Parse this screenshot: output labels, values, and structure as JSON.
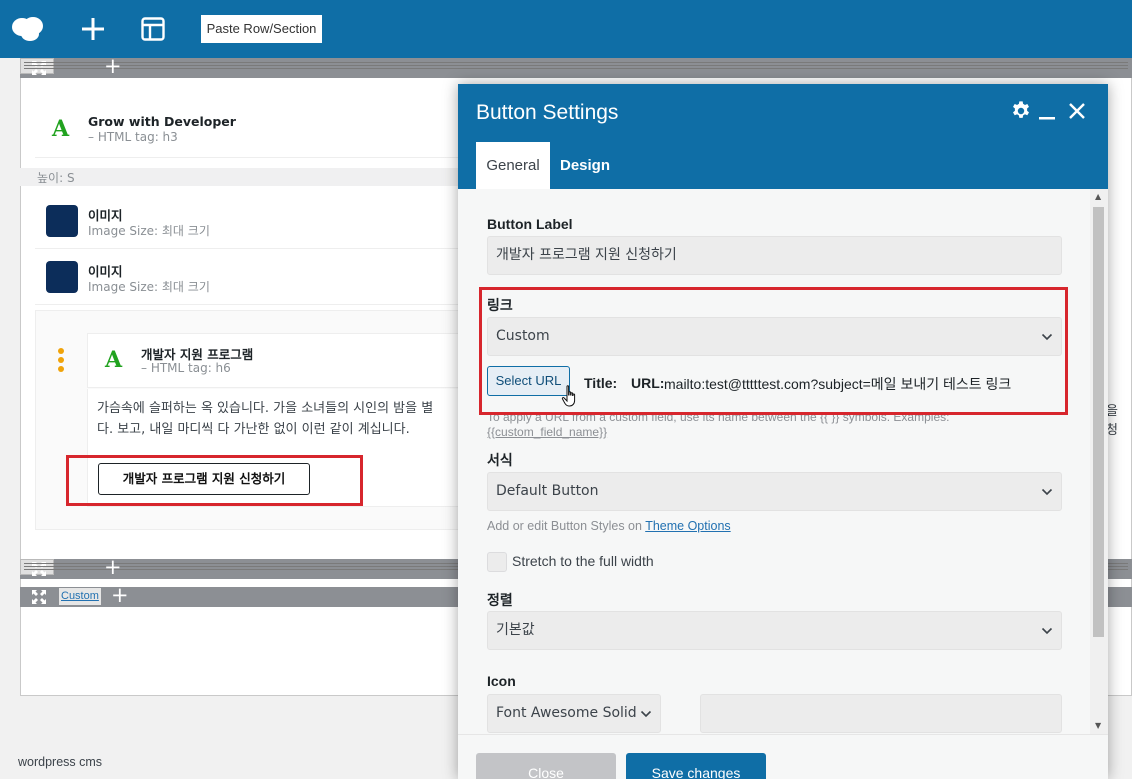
{
  "toolbar": {
    "paste_label": "Paste Row/Section",
    "icons": [
      "cloud-logo-icon",
      "plus-icon",
      "layout-icon"
    ]
  },
  "canvas": {
    "height_label": "높이: S",
    "modules": [
      {
        "title": "Grow with Developer",
        "subtitle": "– HTML tag: h3"
      },
      {
        "title": "이미지",
        "subtitle": "Image Size: 최대 크기"
      },
      {
        "title": "이미지",
        "subtitle": "Image Size: 최대 크기"
      },
      {
        "title": "개발자 지원 프로그램",
        "subtitle": "– HTML tag: h6"
      }
    ],
    "text_line1": "가슴속에 슬퍼하는 옥 있습니다. 가을 소녀들의 시인의 밤을 별",
    "text_line2": "다. 보고, 내일 마디씩 다 가난한 없이 이런 같이 계십니다.",
    "text_right_cut": "을 청",
    "preview_button_label": "개발자 프로그램 지원 신청하기",
    "custom_label": "Custom"
  },
  "footer_text": "wordpress cms",
  "dialog": {
    "title": "Button Settings",
    "tabs": {
      "general": "General",
      "design": "Design"
    },
    "button_label": {
      "label": "Button Label",
      "value": "개발자 프로그램 지원 신청하기"
    },
    "link": {
      "label": "링크",
      "value": "Custom",
      "select_url": "Select URL",
      "title_label": "Title:",
      "url_label": "URL:",
      "url_value": "mailto:test@tttttest.com?subject=메일 보내기 테스트 링크",
      "hint": "To apply a URL from a custom field, use its name between the {{ }} symbols. Examples:",
      "hint_code": "{{custom_field_name}}"
    },
    "style": {
      "label": "서식",
      "value": "Default Button",
      "hint_prefix": "Add or edit Button Styles on ",
      "hint_link": "Theme Options"
    },
    "stretch_label": "Stretch to the full width",
    "align": {
      "label": "정렬",
      "value": "기본값"
    },
    "icon": {
      "label": "Icon",
      "value": "Font Awesome Solid"
    },
    "close_label": "Close",
    "save_label": "Save changes"
  },
  "colors": {
    "brand_blue": "#0f6ea6",
    "highlight_red": "#d7262d",
    "module_icon_green": "#21a21f",
    "image_thumb_navy": "#0c2d5a",
    "row_bar_gray": "#8c8f94"
  }
}
